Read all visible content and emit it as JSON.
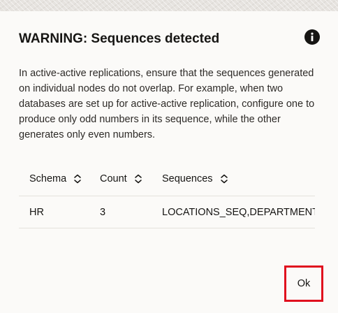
{
  "dialog": {
    "title": "WARNING: Sequences detected",
    "info_icon": "info-circle-icon",
    "message": "In active-active replications, ensure that the sequences generated on individual nodes do not overlap. For example, when two databases are set up for active-active replication, configure one to produce only odd numbers in its sequence, while the other generates only even numbers."
  },
  "table": {
    "columns": [
      {
        "label": "Schema",
        "sort_icon": "sort-icon"
      },
      {
        "label": "Count",
        "sort_icon": "sort-icon"
      },
      {
        "label": "Sequences",
        "sort_icon": "sort-icon"
      }
    ],
    "rows": [
      {
        "schema": "HR",
        "count": "3",
        "sequences": "LOCATIONS_SEQ,DEPARTMENTS_SEQ,EMPLOYEES_SEQ"
      }
    ]
  },
  "footer": {
    "ok_label": "Ok",
    "highlight_color": "#e0101e"
  },
  "colors": {
    "background": "#fbfaf8",
    "text": "#161513",
    "divider": "#e4e1dc"
  }
}
